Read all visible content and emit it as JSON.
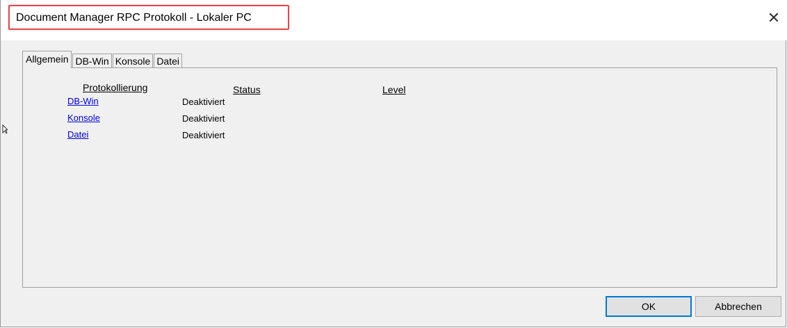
{
  "window": {
    "title": "Document Manager RPC Protokoll - Lokaler PC",
    "close_glyph": "✕",
    "highlight_color": "#e2474e"
  },
  "tabs": [
    {
      "label": "Allgemein",
      "active": true
    },
    {
      "label": "DB-Win",
      "active": false
    },
    {
      "label": "Konsole",
      "active": false
    },
    {
      "label": "Datei",
      "active": false
    }
  ],
  "table": {
    "headers": {
      "protokollierung": "Protokollierung",
      "status": "Status",
      "level": "Level"
    },
    "rows": [
      {
        "name": "DB-Win",
        "status": "Deaktiviert"
      },
      {
        "name": "Konsole",
        "status": "Deaktiviert"
      },
      {
        "name": "Datei",
        "status": "Deaktiviert"
      }
    ]
  },
  "buttons": {
    "ok": "OK",
    "cancel": "Abbrechen"
  }
}
